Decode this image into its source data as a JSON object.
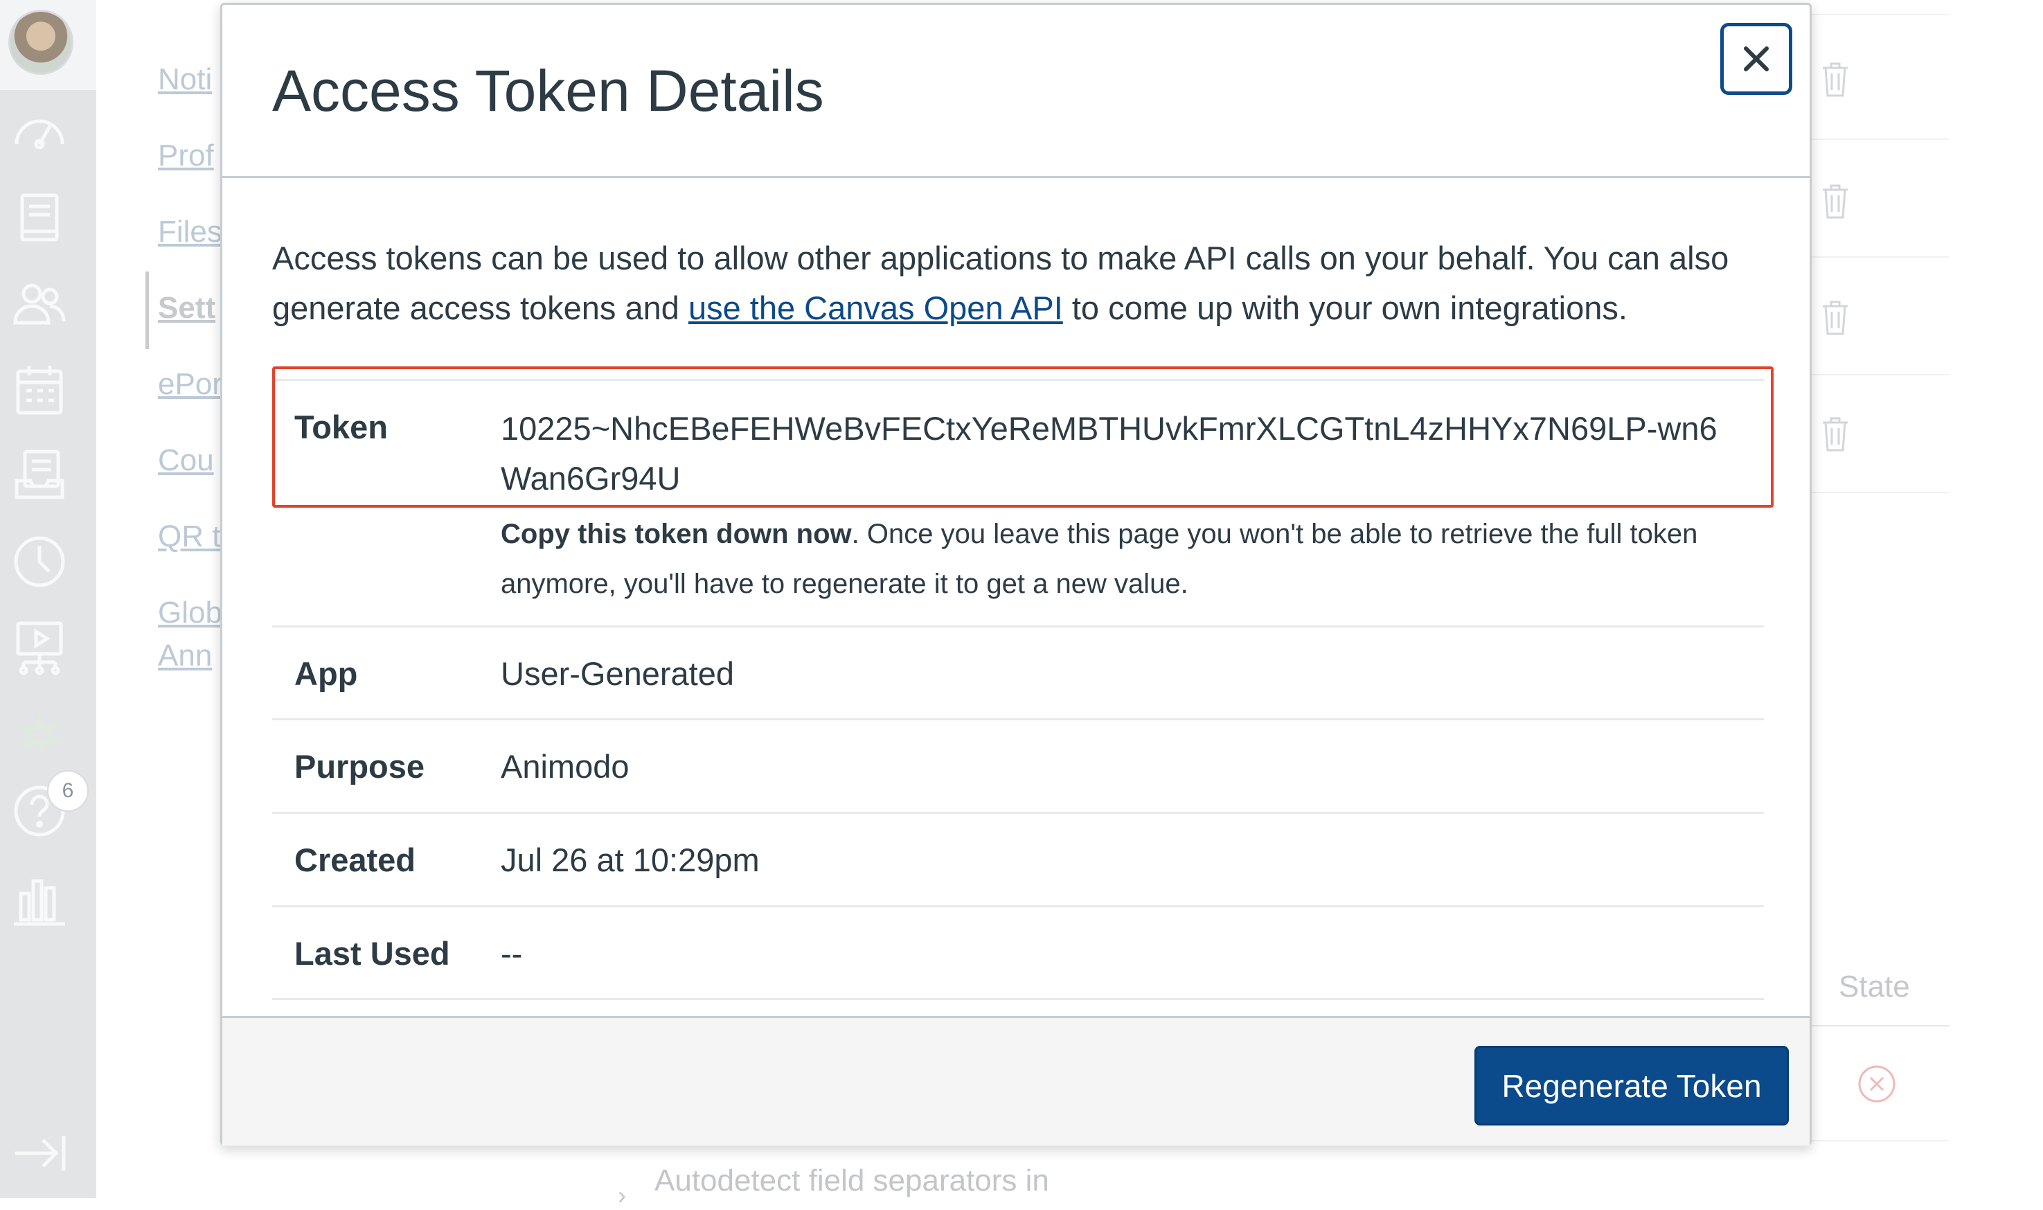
{
  "global_nav": {
    "items": [
      {
        "icon": "dashboard-icon"
      },
      {
        "icon": "courses-icon"
      },
      {
        "icon": "groups-icon"
      },
      {
        "icon": "calendar-icon"
      },
      {
        "icon": "inbox-icon"
      },
      {
        "icon": "history-icon"
      },
      {
        "icon": "commons-icon"
      },
      {
        "icon": "studio-icon"
      },
      {
        "icon": "help-icon"
      },
      {
        "icon": "analytics-icon"
      }
    ],
    "help_badge": "6",
    "collapse_icon": "collapse-nav-icon"
  },
  "background": {
    "left_menu": [
      "Noti",
      "Prof",
      "Files",
      "Sett",
      "ePor",
      "Cou",
      "QR t",
      "Glob",
      "Ann"
    ],
    "state_header": "State",
    "bottom_text": "Autodetect field separators in"
  },
  "modal": {
    "title": "Access Token Details",
    "intro_before_link": "Access tokens can be used to allow other applications to make API calls on your behalf. You can also generate access tokens and ",
    "intro_link": "use the Canvas Open API",
    "intro_after_link": " to come up with your own integrations.",
    "token_label": "Token",
    "token_value": "10225~NhcEBeFEHWeBvFECtxYeReMBTHUvkFmrXLCGTtnL4zHHYx7N69LP-wn6Wan6Gr94U",
    "token_note_bold": "Copy this token down now",
    "token_note_rest": ". Once you leave this page you won't be able to retrieve the full token anymore, you'll have to regenerate it to get a new value.",
    "rows": [
      {
        "label": "App",
        "value": "User-Generated"
      },
      {
        "label": "Purpose",
        "value": "Animodo"
      },
      {
        "label": "Created",
        "value": "Jul 26 at 10:29pm"
      },
      {
        "label": "Last Used",
        "value": "--"
      }
    ],
    "regenerate_label": "Regenerate Token",
    "colors": {
      "primary": "#0b4a8b",
      "highlight": "#e3432b"
    }
  }
}
